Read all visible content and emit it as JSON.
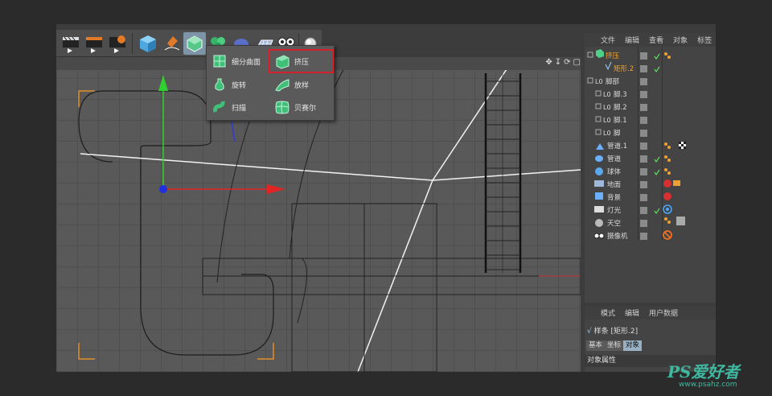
{
  "popup_menu": {
    "items": [
      {
        "label": "细分曲面",
        "icon": "subdivision-surface-icon"
      },
      {
        "label": "挤压",
        "icon": "extrude-icon"
      },
      {
        "label": "旋转",
        "icon": "lathe-icon"
      },
      {
        "label": "放样",
        "icon": "loft-icon"
      },
      {
        "label": "扫描",
        "icon": "sweep-icon"
      },
      {
        "label": "贝赛尔",
        "icon": "bezier-icon"
      }
    ]
  },
  "object_manager": {
    "menu": [
      "文件",
      "编辑",
      "查看",
      "对象",
      "标签"
    ],
    "rows": [
      {
        "label": "挤压",
        "color": "#f0a030"
      },
      {
        "label": "矩形.2",
        "color": "#f0a030"
      },
      {
        "label": "脚部"
      },
      {
        "label": "脚.3"
      },
      {
        "label": "脚.2"
      },
      {
        "label": "脚.1"
      },
      {
        "label": "脚"
      },
      {
        "label": "管道.1"
      },
      {
        "label": "管道"
      },
      {
        "label": "球体"
      },
      {
        "label": "地面"
      },
      {
        "label": "背景"
      },
      {
        "label": "灯光"
      },
      {
        "label": "天空"
      },
      {
        "label": "摄像机"
      }
    ]
  },
  "attribute_manager": {
    "menu": [
      "模式",
      "编辑",
      "用户数据"
    ],
    "object_title": "样条 [矩形.2]",
    "tabs": [
      "基本",
      "坐标",
      "对象"
    ],
    "section": "对象属性"
  },
  "watermark": {
    "brand": "PS爱好者",
    "url": "www.psahz.com"
  },
  "colors": {
    "accent_highlight": "#d6202a",
    "active_tab": "#98b0c2",
    "selection_orange": "#f0a030"
  }
}
